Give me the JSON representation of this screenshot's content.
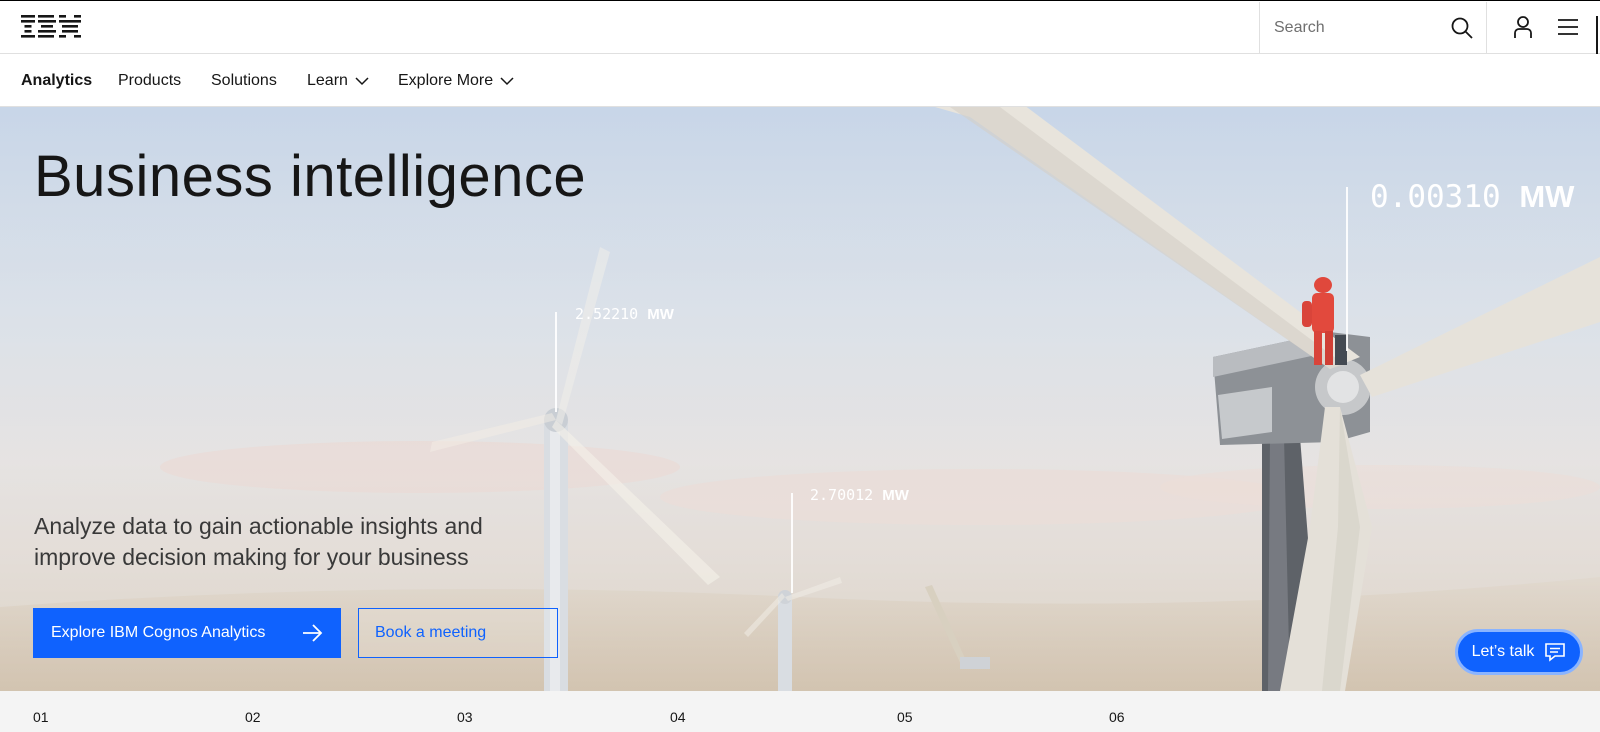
{
  "masthead": {
    "logo_text": "IBM",
    "search": {
      "placeholder": "Search"
    }
  },
  "nav": {
    "brand": "Analytics",
    "items": [
      {
        "label": "Products"
      },
      {
        "label": "Solutions"
      },
      {
        "label": "Learn"
      },
      {
        "label": "Explore More"
      }
    ]
  },
  "hero": {
    "title": "Business intelligence",
    "subtitle": "Analyze data to gain actionable insights and improve decision making for your business",
    "primary_cta": "Explore IBM Cognos Analytics",
    "secondary_cta": "Book a meeting",
    "readouts": [
      {
        "value": "0.00310",
        "unit": "MW"
      },
      {
        "value": "2.52210",
        "unit": "MW"
      },
      {
        "value": "2.70012",
        "unit": "MW"
      }
    ]
  },
  "chat": {
    "label": "Let’s talk"
  },
  "steps": [
    "01",
    "02",
    "03",
    "04",
    "05",
    "06"
  ],
  "colors": {
    "accent": "#0f62fe",
    "text": "#161616",
    "strip": "#f4f4f4"
  },
  "icons": [
    "search-icon",
    "user-icon",
    "menu-icon",
    "chevron-down-icon",
    "arrow-right-icon",
    "chat-icon"
  ]
}
